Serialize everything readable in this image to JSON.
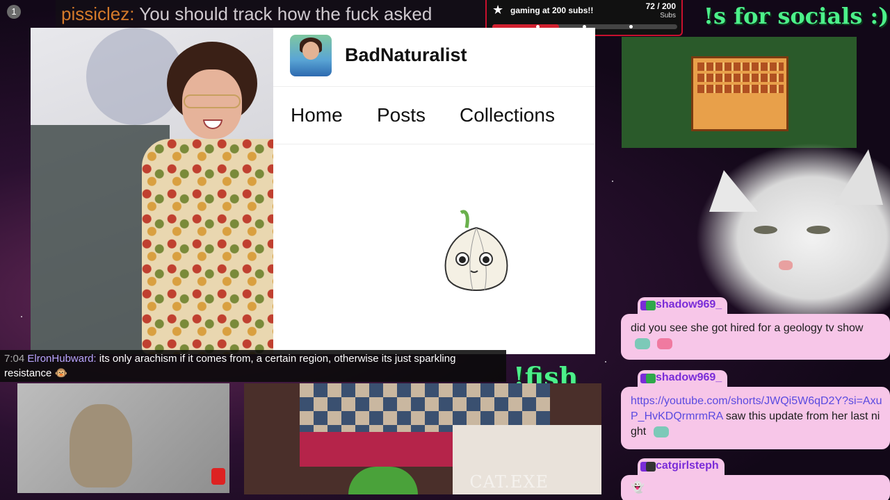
{
  "ticker": {
    "user": "pissiclez:",
    "message": "You should track how the fuck asked"
  },
  "notif_count": "1",
  "sub_goal": {
    "title": "gaming at 200 subs!!",
    "count": "72 / 200",
    "unit": "Subs",
    "progress": 0.36
  },
  "socials_text": "!s for socials :)",
  "fish_text": "!fish",
  "profile": {
    "name": "BadNaturalist",
    "nav": [
      "Home",
      "Posts",
      "Collections"
    ]
  },
  "chat_overlay": {
    "time": "7:04",
    "user": "ElronHubward:",
    "message": "its only arachism if it comes from, a certain region, otherwise its just sparkling resistance"
  },
  "cam_label": "CAT.EXE",
  "chat": [
    {
      "user": "shadow969_",
      "message": "did you see she got hired for a geology tv show"
    },
    {
      "user": "shadow969_",
      "link": "https://youtube.com/shorts/JWQi5W6qD2Y?si=AxuP_HvKDQrmrmRA",
      "message": " saw this update from her last night"
    },
    {
      "user": "catgirlsteph",
      "message": ""
    }
  ],
  "colors": {
    "accent_green": "#4cf08a",
    "goal_red": "#d1202f",
    "chat_bg": "#f7c6e8",
    "chat_name": "#7a2cd8"
  }
}
